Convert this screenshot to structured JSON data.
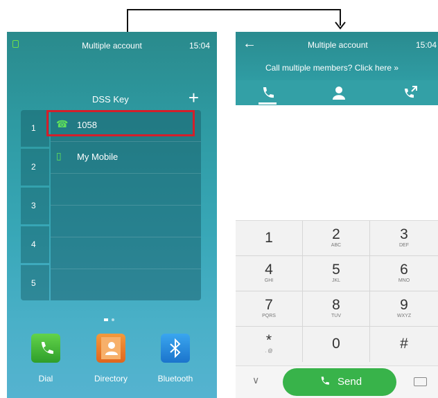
{
  "left_phone": {
    "status": {
      "title": "Multiple account",
      "time": "15:04"
    },
    "dss": {
      "title": "DSS Key",
      "plus_glyph": "+",
      "numbers": [
        "1",
        "2",
        "3",
        "4",
        "5"
      ],
      "rows": [
        {
          "icon": "phone-icon",
          "label": "1058"
        },
        {
          "icon": "mobile-icon",
          "label": "My Mobile"
        }
      ]
    },
    "dock": [
      {
        "label": "Dial",
        "icon": "dial-icon"
      },
      {
        "label": "Directory",
        "icon": "directory-icon"
      },
      {
        "label": "Bluetooth",
        "icon": "bluetooth-icon"
      }
    ]
  },
  "right_phone": {
    "header": {
      "back_glyph": "←",
      "title": "Multiple account",
      "time": "15:04",
      "call_multiple": "Call multiple members? Click here  »"
    },
    "tabs": [
      "dial-tab-icon",
      "contacts-tab-icon",
      "history-tab-icon"
    ],
    "keypad": [
      {
        "num": "1",
        "sub": ""
      },
      {
        "num": "2",
        "sub": "ABC"
      },
      {
        "num": "3",
        "sub": "DEF"
      },
      {
        "num": "4",
        "sub": "GHI"
      },
      {
        "num": "5",
        "sub": "JKL"
      },
      {
        "num": "6",
        "sub": "MNO"
      },
      {
        "num": "7",
        "sub": "PQRS"
      },
      {
        "num": "8",
        "sub": "TUV"
      },
      {
        "num": "9",
        "sub": "WXYZ"
      },
      {
        "num": "*",
        "sub": ". @"
      },
      {
        "num": "0",
        "sub": ""
      },
      {
        "num": "#",
        "sub": ""
      }
    ],
    "send_label": "Send",
    "chevron_glyph": "∨"
  },
  "colors": {
    "accent_teal": "#2f9ca3",
    "send_green": "#38b34a",
    "highlight_red": "#d41f2a"
  }
}
